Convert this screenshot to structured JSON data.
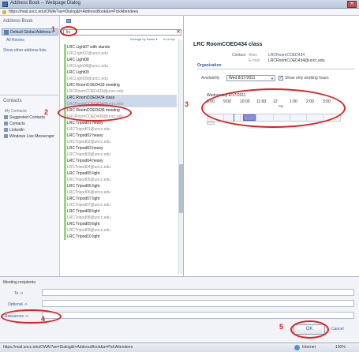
{
  "window": {
    "title": "Address Book -- Webpage Dialog",
    "url": "https://mail.uncc.edu/OWA/?ae=Dialog&t=AddressBook&a=PickAttendees",
    "close_label": "✕"
  },
  "left_pane": {
    "title": "Address Book",
    "selected_book": "Default Global Address...",
    "all_rooms": "All Rooms",
    "show_other": "Show other address lists",
    "contacts_title": "Contacts",
    "my_contacts": "My Contacts",
    "contact_folders": [
      "Suggested Contacts",
      "Contacts",
      "LinkedIn",
      "Windows Live Messenger"
    ]
  },
  "search": {
    "value": "lrc",
    "arrange": "Arrange by Name",
    "on_top": "A on top"
  },
  "results": [
    {
      "name": "LRC Light07 with stands",
      "email": "LRCLight07@uncc.edu"
    },
    {
      "name": "LRC Light08",
      "email": "LRCLight08@uncc.edu"
    },
    {
      "name": "LRC Light09",
      "email": "LRCLight09@uncc.edu"
    },
    {
      "name": "LRC RoomCOED433 meeting",
      "email": "LRCRoomCOED433@uncc.edu"
    },
    {
      "name": "LRC RoomCOED434 class",
      "email": "LRCRoomCOED434@uncc.edu"
    },
    {
      "name": "LRC RoomCOED436 meeting",
      "email": "LRCRoomCOED436@uncc.edu"
    },
    {
      "name": "LRC Tripod01 heavy",
      "email": "LRCTripod01@uncc.edu"
    },
    {
      "name": "LRC Tripod02 heavy",
      "email": "LRCTripod02@uncc.edu"
    },
    {
      "name": "LRC Tripod03 heavy",
      "email": "LRCTripod03@uncc.edu"
    },
    {
      "name": "LRC Tripod04 heavy",
      "email": "LRCTripod04@uncc.edu"
    },
    {
      "name": "LRC Tripod05 light",
      "email": "LRCTripod05@uncc.edu"
    },
    {
      "name": "LRC Tripod06 light",
      "email": "LRCTripod06@uncc.edu"
    },
    {
      "name": "LRC Tripod07 light",
      "email": "LRCTripod07@uncc.edu"
    },
    {
      "name": "LRC Tripod08 light",
      "email": "LRCTripod08@uncc.edu"
    },
    {
      "name": "LRC Tripod09 light",
      "email": "LRCTripod09@uncc.edu"
    },
    {
      "name": "LRC Tripod10 light",
      "email": ""
    }
  ],
  "detail": {
    "title": "LRC RoomCOED434 class",
    "contact_label": "Contact",
    "alias_label": "Alias",
    "alias_value": "LRCRoomCOED434",
    "email_label": "E-mail",
    "email_value": "LRCRoomCOED434@uncc.edu",
    "section": "Organization",
    "availability_label": "Availability",
    "date_value": "Wed 8/17/2011",
    "only_hours": "Show only working hours",
    "timeline_date": "Wednesday 8/17/2011",
    "hours": [
      "8:00",
      "9:00",
      "10:00",
      "11:00",
      "12",
      "1:00",
      "2:00",
      "3:00"
    ],
    "pm_label": "PM"
  },
  "bottom": {
    "meeting_recipients": "Meeting recipients:",
    "to": "To ->",
    "optional": "Optional ->",
    "resources": "Resources ->",
    "ok": "OK",
    "cancel": "Cancel"
  },
  "status": {
    "url": "https://mail.uncc.edu/OWA/?ae=Dialog&t=AddressBook&a=PickAttendees",
    "zone": "Internet",
    "zoom": "100%"
  },
  "annotations": [
    "1",
    "2",
    "3",
    "4",
    "5"
  ]
}
